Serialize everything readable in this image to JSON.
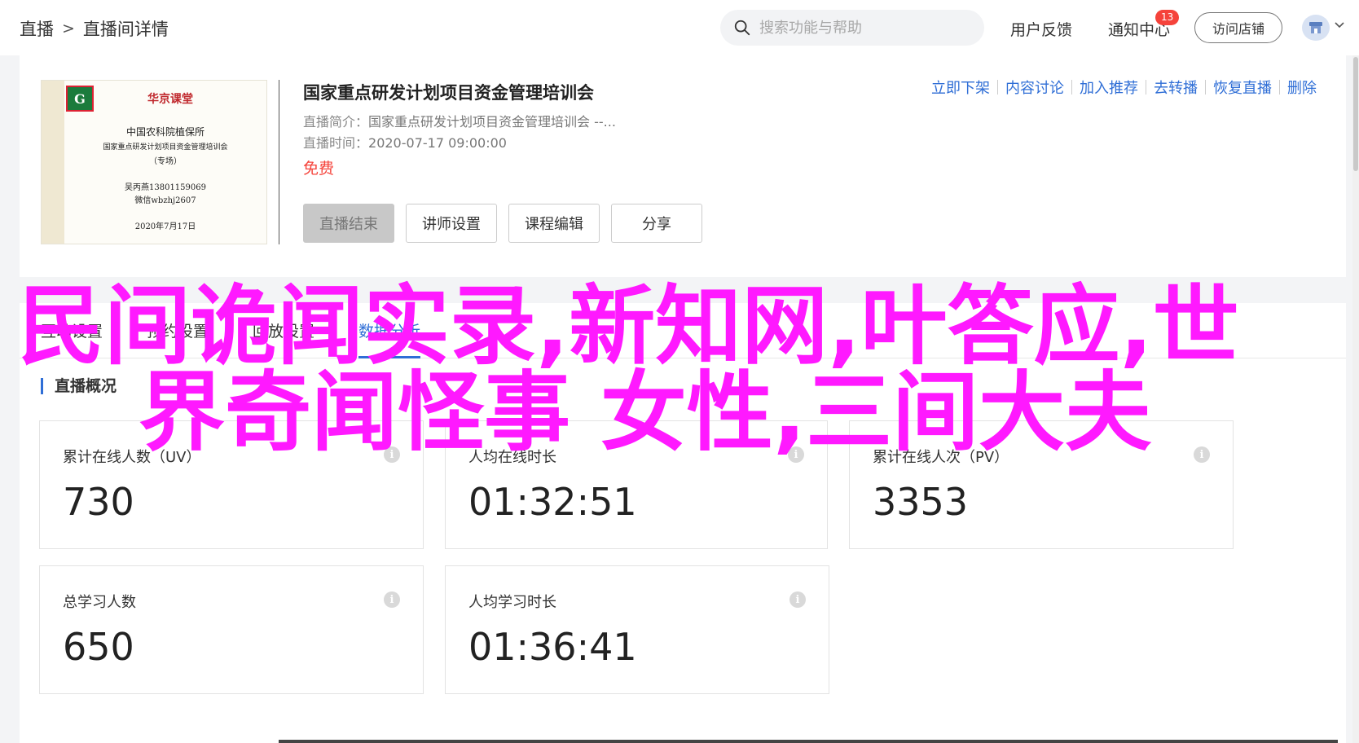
{
  "header": {
    "breadcrumb": [
      "直播",
      "直播间详情"
    ],
    "breadcrumb_sep": ">",
    "search_placeholder": "搜索功能与帮助",
    "feedback": "用户反馈",
    "notifications": "通知中心",
    "notification_count": "13",
    "visit_store": "访问店铺"
  },
  "course": {
    "cover": {
      "brand": "华京课堂",
      "org": "中国农科院植保所",
      "line1": "国家重点研发计划项目资金管理培训会",
      "line2": "（专场）",
      "contact1": "吴丙燕13801159069",
      "contact2": "微信wbzhj2607",
      "date": "2020年7月17日",
      "logo_glyph": "G"
    },
    "title": "国家重点研发计划项目资金管理培训会",
    "intro_label": "直播简介：",
    "intro_value": "国家重点研发计划项目资金管理培训会 --...",
    "time_label": "直播时间：",
    "time_value": "2020-07-17 09:00:00",
    "price": "免费",
    "buttons": [
      "直播结束",
      "讲师设置",
      "课程编辑",
      "分享"
    ],
    "actions": [
      "立即下架",
      "内容讨论",
      "加入推荐",
      "去转播",
      "恢复直播",
      "删除"
    ]
  },
  "tabs": [
    "互动设置",
    "预约设置",
    "回放设置",
    "数据分析"
  ],
  "active_tab": "数据分析",
  "section_title": "直播概况",
  "stats": [
    {
      "label": "累计在线人数（UV）",
      "value": "730"
    },
    {
      "label": "人均在线时长",
      "value": "01:32:51"
    },
    {
      "label": "累计在线人次（PV）",
      "value": "3353"
    },
    {
      "label": "总学习人数",
      "value": "650"
    },
    {
      "label": "人均学习时长",
      "value": "01:36:41"
    }
  ],
  "overlay": {
    "line1": "民间诡闻实录,新知网,叶答应,世",
    "line2": "界奇闻怪事 女性,三间大夫"
  },
  "colors": {
    "accent": "#2f6ed6",
    "price": "#f5433b",
    "overlay": "#ff19ff"
  }
}
